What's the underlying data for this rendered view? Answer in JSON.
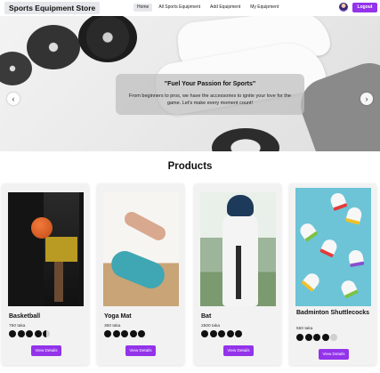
{
  "navbar": {
    "brand": "Sports Equipment Store",
    "links": [
      "Home",
      "All Sports Equipment",
      "Add Equipment",
      "My Equipment"
    ],
    "logout_label": "Logout"
  },
  "hero": {
    "title": "\"Fuel Your Passion for Sports\"",
    "subtitle": "From beginners to pros, we have the accessories to ignite your love for the game. Let's make every moment count!",
    "prev_icon": "chevron-left-icon",
    "next_icon": "chevron-right-icon"
  },
  "products_section": {
    "title": "Products",
    "items": [
      {
        "name": "Basketball",
        "price": "750 taka",
        "rating": 4.5,
        "button": "View Details"
      },
      {
        "name": "Yoga Mat",
        "price": "350 taka",
        "rating": 5,
        "button": "View Details"
      },
      {
        "name": "Bat",
        "price": "2500 taka",
        "rating": 5,
        "button": "View Details"
      },
      {
        "name": "Badminton Shuttlecocks",
        "price": "550 taka",
        "rating": 4,
        "button": "View Details"
      }
    ]
  },
  "colors": {
    "accent": "#9333ea",
    "nav_active": "#e5e7eb"
  }
}
